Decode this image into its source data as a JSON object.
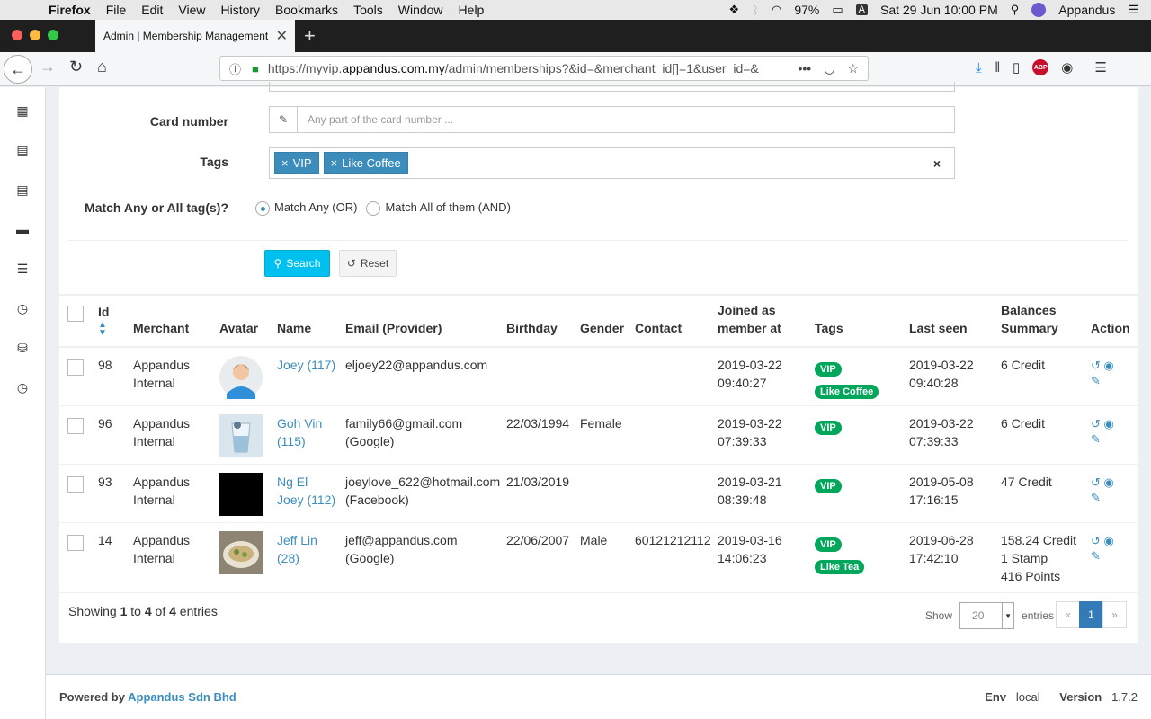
{
  "menubar": {
    "app": "Firefox",
    "items": [
      "File",
      "Edit",
      "View",
      "History",
      "Bookmarks",
      "Tools",
      "Window",
      "Help"
    ],
    "battery": "97%",
    "input_source": "A",
    "datetime": "Sat 29 Jun  10:00 PM",
    "user": "Appandus"
  },
  "browser": {
    "tab_title": "Admin | Membership Management",
    "url_prefix": "https://myvip.",
    "url_domain": "appandus.com.my",
    "url_rest": "/admin/memberships?&id=&merchant_id[]=1&user_id=&"
  },
  "filters": {
    "card_label": "Card number",
    "card_placeholder": "Any part of the card number ...",
    "tags_label": "Tags",
    "tags": [
      "VIP",
      "Like Coffee"
    ],
    "match_label": "Match Any or All tag(s)?",
    "match_any": "Match Any (OR)",
    "match_all": "Match All of them (AND)",
    "search_btn": "Search",
    "reset_btn": "Reset"
  },
  "table": {
    "headers": {
      "id": "Id",
      "merchant": "Merchant",
      "avatar": "Avatar",
      "name": "Name",
      "email": "Email (Provider)",
      "birthday": "Birthday",
      "gender": "Gender",
      "contact": "Contact",
      "joined_1": "Joined as",
      "joined_2": "member at",
      "tags": "Tags",
      "last_seen": "Last seen",
      "balances_1": "Balances",
      "balances_2": "Summary",
      "action": "Action"
    },
    "rows": [
      {
        "id": "98",
        "merchant_1": "Appandus",
        "merchant_2": "Internal",
        "name_1": "Joey (117)",
        "name_2": "",
        "email_1": "eljoey22@appandus.com",
        "email_2": "",
        "birthday": "",
        "gender": "",
        "contact": "",
        "joined_1": "2019-03-22",
        "joined_2": "09:40:27",
        "tag_1": "VIP",
        "tag_2": "Like Coffee",
        "seen_1": "2019-03-22",
        "seen_2": "09:40:28",
        "bal_1": "6 Credit",
        "bal_2": "",
        "bal_3": ""
      },
      {
        "id": "96",
        "merchant_1": "Appandus",
        "merchant_2": "Internal",
        "name_1": "Goh Vin",
        "name_2": "(115)",
        "email_1": "family66@gmail.com",
        "email_2": "(Google)",
        "birthday": "22/03/1994",
        "gender": "Female",
        "contact": "",
        "joined_1": "2019-03-22",
        "joined_2": "07:39:33",
        "tag_1": "VIP",
        "tag_2": "",
        "seen_1": "2019-03-22",
        "seen_2": "07:39:33",
        "bal_1": "6 Credit",
        "bal_2": "",
        "bal_3": ""
      },
      {
        "id": "93",
        "merchant_1": "Appandus",
        "merchant_2": "Internal",
        "name_1": "Ng El",
        "name_2": "Joey (112)",
        "email_1": "joeylove_622@hotmail.com",
        "email_2": "(Facebook)",
        "birthday": "21/03/2019",
        "gender": "",
        "contact": "",
        "joined_1": "2019-03-21",
        "joined_2": "08:39:48",
        "tag_1": "VIP",
        "tag_2": "",
        "seen_1": "2019-05-08",
        "seen_2": "17:16:15",
        "bal_1": "47 Credit",
        "bal_2": "",
        "bal_3": ""
      },
      {
        "id": "14",
        "merchant_1": "Appandus",
        "merchant_2": "Internal",
        "name_1": "Jeff Lin",
        "name_2": "(28)",
        "email_1": "jeff@appandus.com",
        "email_2": "(Google)",
        "birthday": "22/06/2007",
        "gender": "Male",
        "contact": "60121212112",
        "joined_1": "2019-03-16",
        "joined_2": "14:06:23",
        "tag_1": "VIP",
        "tag_2": "Like Tea",
        "seen_1": "2019-06-28",
        "seen_2": "17:42:10",
        "bal_1": "158.24 Credit",
        "bal_2": "1 Stamp",
        "bal_3": "416 Points"
      }
    ]
  },
  "footer_info": {
    "prefix": "Showing ",
    "from": "1",
    "to_word": " to ",
    "to": "4",
    "of_word": " of ",
    "total": "4",
    "suffix": " entries",
    "show_label": "Show",
    "page_size": "20",
    "entries_label": "entries",
    "prev": "«",
    "page": "1",
    "next": "»"
  },
  "page_footer": {
    "powered": "Powered by ",
    "company": "Appandus Sdn Bhd",
    "env_label": "Env",
    "env_value": "local",
    "version_label": "Version",
    "version_value": "1.7.2"
  },
  "colors": {
    "primary": "#3c8dbc",
    "badge_green": "#00a65a",
    "search_btn": "#00c0ef"
  }
}
